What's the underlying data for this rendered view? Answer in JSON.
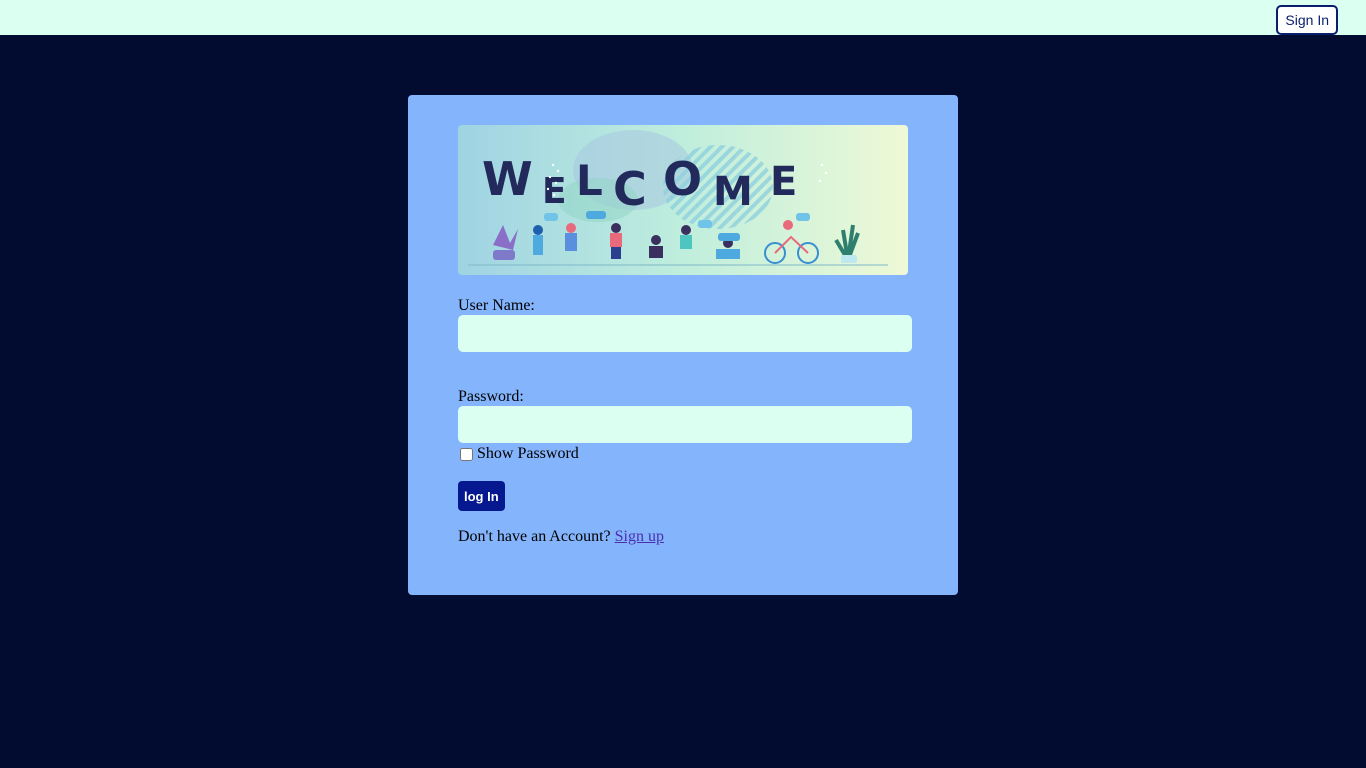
{
  "header": {
    "signin_label": "Sign In"
  },
  "banner": {
    "text": "WELCOME"
  },
  "form": {
    "username_label": "User Name:",
    "username_value": "",
    "password_label": "Password:",
    "password_value": "",
    "show_password_label": "Show Password",
    "show_password_checked": false,
    "login_label": "log In",
    "signup_prompt": "Don't have an Account?",
    "signup_link": "Sign up"
  },
  "colors": {
    "page_bg": "#020b30",
    "topbar_bg": "#dbfff1",
    "card_bg": "#84b4fc",
    "input_bg": "#dbfff1",
    "login_button_bg": "#05188f",
    "link_color": "#4b2fb0"
  }
}
